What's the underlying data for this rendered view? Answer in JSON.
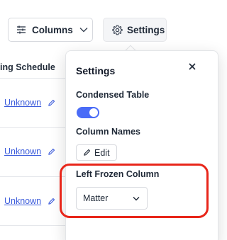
{
  "toolbar": {
    "columns_label": "Columns",
    "settings_label": "Settings"
  },
  "table": {
    "column_header": "ing Schedule",
    "rows": [
      {
        "value": "Unknown"
      },
      {
        "value": "Unknown"
      },
      {
        "value": "Unknown"
      }
    ]
  },
  "settings_panel": {
    "title": "Settings",
    "condensed_table_label": "Condensed Table",
    "condensed_table_on": true,
    "column_names_label": "Column Names",
    "edit_label": "Edit",
    "left_frozen_column_label": "Left Frozen Column",
    "left_frozen_column_value": "Matter"
  },
  "colors": {
    "accent": "#4a6cf7",
    "link": "#3b5bdb",
    "highlight": "#e8261a"
  },
  "icons": {
    "columns": "sliders-icon",
    "settings": "gear-icon",
    "close": "close-icon",
    "edit": "pencil-icon",
    "dropdown": "chevron-down-icon"
  }
}
